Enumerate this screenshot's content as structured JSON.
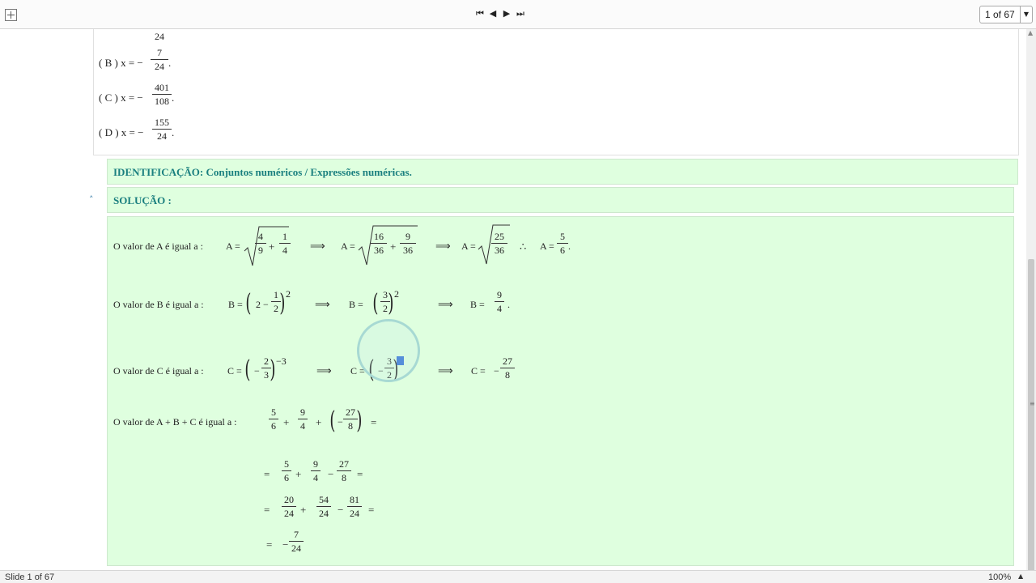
{
  "toolbar": {
    "first": "⏮",
    "prev": "◀",
    "next": "▶",
    "last": "⏭",
    "counter": "1 of 67",
    "dropdown": "▼"
  },
  "options": {
    "a_tail": "24",
    "b": {
      "label": "( B )  x  =  −",
      "num": "7",
      "den": "24",
      "end": "."
    },
    "c": {
      "label": "( C )  x  =  −",
      "num": "401",
      "den": "108",
      "end": "."
    },
    "d": {
      "label": "( D )  x  =  −",
      "num": "155",
      "den": "24",
      "end": "."
    }
  },
  "identificacao": "IDENTIFICAÇÃO:  Conjuntos numéricos / Expressões numéricas.",
  "solucao": "SOLUÇÃO :",
  "collapse_icon": "˄",
  "solution": {
    "lineA": {
      "label": "O valor de A é igual a :",
      "A": "A =",
      "n1": "4",
      "d1": "9",
      "plus": "+",
      "n2": "1",
      "d2": "4",
      "imp": "⟹",
      "A2": "A =",
      "n3": "16",
      "d3": "36",
      "plus2": "+",
      "n4": "9",
      "d4": "36",
      "imp2": "⟹",
      "A3": "A =",
      "n5": "25",
      "d5": "36",
      "therefore": "∴",
      "A4": "A =",
      "n6": "5",
      "d6": "6",
      "end": "."
    },
    "lineB": {
      "label": "O valor de B é igual a :",
      "B": "B =",
      "two": "2 −",
      "n1": "1",
      "d1": "2",
      "exp": "2",
      "imp": "⟹",
      "B2": "B  =",
      "n2": "3",
      "d2": "2",
      "exp2": "2",
      "imp2": "⟹",
      "B3": "B  =",
      "n3": "9",
      "d3": "4",
      "end": "."
    },
    "lineC": {
      "label": "O valor de C é igual a :",
      "C": "C =",
      "minus": "−",
      "n1": "2",
      "d1": "3",
      "exp": "−3",
      "imp": "⟹",
      "C2": "C =",
      "minus2": "−",
      "n2": "3",
      "d2": "2",
      "exp2": "3",
      "imp2": "⟹",
      "C3": "C =",
      "minus3": "−",
      "n3": "27",
      "d3": "8"
    },
    "lineSum": {
      "label": "O valor de A  +  B  +  C  é  igual a :",
      "n1": "5",
      "d1": "6",
      "plus": "+",
      "n2": "9",
      "d2": "4",
      "plus2": "+",
      "minus": "−",
      "n3": "27",
      "d3": "8",
      "eq": "="
    },
    "step1": {
      "eq": "=",
      "n1": "5",
      "d1": "6",
      "plus": "+",
      "n2": "9",
      "d2": "4",
      "minus": "−",
      "n3": "27",
      "d3": "8",
      "eq2": "="
    },
    "step2": {
      "eq": "=",
      "n1": "20",
      "d1": "24",
      "plus": "+",
      "n2": "54",
      "d2": "24",
      "minus": "−",
      "n3": "81",
      "d3": "24",
      "eq2": "="
    },
    "step3": {
      "eq": "=",
      "minus": "−",
      "n1": "7",
      "d1": "24"
    }
  },
  "status": {
    "slide": "Slide 1 of 67",
    "zoom": "100%",
    "zoom_icon": "▲"
  },
  "scroll_up_icon": "▲",
  "grip_icon": "≡"
}
